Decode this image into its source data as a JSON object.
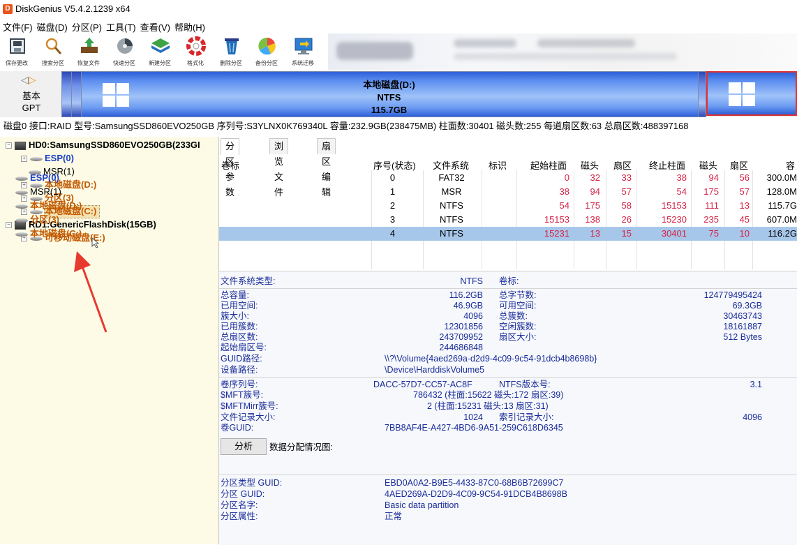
{
  "window": {
    "title": "DiskGenius V5.4.2.1239 x64",
    "app_icon": "D"
  },
  "menu": [
    "文件(F)",
    "磁盘(D)",
    "分区(P)",
    "工具(T)",
    "查看(V)",
    "帮助(H)"
  ],
  "toolbar": [
    {
      "label": "保存更改",
      "icon": "save-changes-icon"
    },
    {
      "label": "搜索分区",
      "icon": "search-partition-icon"
    },
    {
      "label": "恢复文件",
      "icon": "recover-files-icon"
    },
    {
      "label": "快速分区",
      "icon": "quick-partition-icon"
    },
    {
      "label": "新建分区",
      "icon": "new-partition-icon"
    },
    {
      "label": "格式化",
      "icon": "format-icon"
    },
    {
      "label": "删除分区",
      "icon": "delete-partition-icon"
    },
    {
      "label": "备份分区",
      "icon": "backup-partition-icon"
    },
    {
      "label": "系统迁移",
      "icon": "system-migration-icon"
    }
  ],
  "disk_map": {
    "disk_type_line1": "基本",
    "disk_type_line2": "GPT",
    "selected_partition": {
      "name": "本地磁盘(D:)",
      "fs": "NTFS",
      "size": "115.7GB"
    }
  },
  "disk_info": "磁盘0 接口:RAID  型号:SamsungSSD860EVO250GB  序列号:S3YLNX0K769340L  容量:232.9GB(238475MB)  柱面数:30401  磁头数:255  每道扇区数:63  总扇区数:488397168",
  "tree": {
    "disk0": "HD0:SamsungSSD860EVO250GB(233GI",
    "disk0_parts": [
      {
        "label": "ESP(0)",
        "style": "blue"
      },
      {
        "label": "MSR(1)",
        "style": "plain"
      },
      {
        "label": "本地磁盘(D:)",
        "style": "orange"
      },
      {
        "label": "分区(3)",
        "style": "orange"
      },
      {
        "label": "本地磁盘(C:)",
        "style": "orange"
      }
    ],
    "disk1": "RD1:GenericFlashDisk(15GB)",
    "disk1_parts": [
      {
        "label": "可移动磁盘(E:)",
        "style": "orange"
      }
    ]
  },
  "tabs": [
    "分区参数",
    "浏览文件",
    "扇区编辑"
  ],
  "table": {
    "headers": [
      "卷标",
      "序号(状态)",
      "文件系统",
      "标识",
      "起始柱面",
      "磁头",
      "扇区",
      "终止柱面",
      "磁头",
      "扇区",
      "容"
    ],
    "rows": [
      {
        "label": "ESP(0)",
        "num": "0",
        "fs": "FAT32",
        "id": "",
        "sc": "0",
        "sh": "32",
        "ss": "33",
        "ec": "38",
        "eh": "94",
        "es": "56",
        "cap": "300.0M"
      },
      {
        "label": "MSR(1)",
        "num": "1",
        "fs": "MSR",
        "id": "",
        "sc": "38",
        "sh": "94",
        "ss": "57",
        "ec": "54",
        "eh": "175",
        "es": "57",
        "cap": "128.0M"
      },
      {
        "label": "本地磁盘(D:)",
        "num": "2",
        "fs": "NTFS",
        "id": "",
        "sc": "54",
        "sh": "175",
        "ss": "58",
        "ec": "15153",
        "eh": "111",
        "es": "13",
        "cap": "115.7G"
      },
      {
        "label": "分区(3)",
        "num": "3",
        "fs": "NTFS",
        "id": "",
        "sc": "15153",
        "sh": "138",
        "ss": "26",
        "ec": "15230",
        "eh": "235",
        "es": "45",
        "cap": "607.0M"
      },
      {
        "label": "本地磁盘(C:)",
        "num": "4",
        "fs": "NTFS",
        "id": "",
        "sc": "15231",
        "sh": "13",
        "ss": "15",
        "ec": "30401",
        "eh": "75",
        "es": "10",
        "cap": "116.2G"
      }
    ]
  },
  "details": {
    "fs_type_label": "文件系统类型:",
    "fs_type": "NTFS",
    "volume_label": "卷标:",
    "total_cap_label": "总容量:",
    "total_cap": "116.2GB",
    "total_bytes_label": "总字节数:",
    "total_bytes": "124779495424",
    "used_label": "已用空间:",
    "used": "46.9GB",
    "free_label": "可用空间:",
    "free": "69.3GB",
    "cluster_size_label": "簇大小:",
    "cluster_size": "4096",
    "total_clusters_label": "总簇数:",
    "total_clusters": "30463743",
    "used_clusters_label": "已用簇数:",
    "used_clusters": "12301856",
    "free_clusters_label": "空闲簇数:",
    "free_clusters": "18161887",
    "total_sectors_label": "总扇区数:",
    "total_sectors": "243709952",
    "sector_size_label": "扇区大小:",
    "sector_size": "512 Bytes",
    "start_sector_label": "起始扇区号:",
    "start_sector": "244686848",
    "guid_path_label": "GUID路径:",
    "guid_path": "\\\\?\\Volume{4aed269a-d2d9-4c09-9c54-91dcb4b8698b}",
    "device_path_label": "设备路径:",
    "device_path": "\\Device\\HarddiskVolume5",
    "serial_label": "卷序列号:",
    "serial": "DACC-57D7-CC57-AC8F",
    "ntfs_ver_label": "NTFS版本号:",
    "ntfs_ver": "3.1",
    "mft_label": "$MFT簇号:",
    "mft": "786432 (柱面:15622 磁头:172 扇区:39)",
    "mftmirr_label": "$MFTMirr簇号:",
    "mftmirr": "2 (柱面:15231 磁头:13 扇区:31)",
    "record_size_label": "文件记录大小:",
    "record_size": "1024",
    "index_size_label": "索引记录大小:",
    "index_size": "4096",
    "vol_guid_label": "卷GUID:",
    "vol_guid": "7BB8AF4E-A427-4BD6-9A51-259C618D6345",
    "analyze_button": "分析",
    "distribution_label": "数据分配情况图:",
    "ptype_guid_label": "分区类型 GUID:",
    "ptype_guid": "EBD0A0A2-B9E5-4433-87C0-68B6B72699C7",
    "pguid_label": "分区 GUID:",
    "pguid": "4AED269A-D2D9-4C09-9C54-91DCB4B8698B",
    "pname_label": "分区名字:",
    "pname": "Basic data partition",
    "pattr_label": "分区属性:",
    "pattr": "正常"
  },
  "colors": {
    "accent_bar": "#3d78f0",
    "selected_row": "#a7c7ea",
    "tree_bg": "#fdfbe6",
    "arrow": "#e8392f"
  }
}
